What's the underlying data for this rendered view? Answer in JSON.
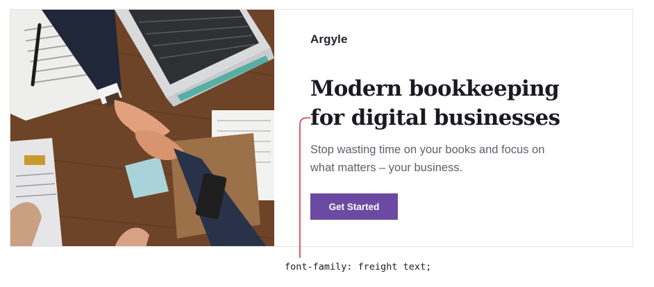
{
  "hero": {
    "brand": "Argyle",
    "headline_line1": "Modern bookkeeping",
    "headline_line2": "for digital businesses",
    "subline_line1": "Stop wasting time on your books and focus on",
    "subline_line2": "what matters – your business.",
    "cta_label": "Get Started",
    "photo_subject": "business-handshake-over-desk",
    "colors": {
      "cta_background": "#6b4aa3",
      "headline": "#1b1a22",
      "subline": "#5f5e6a",
      "annotation_line": "#d8343f"
    }
  },
  "annotation": {
    "caption": "font-family: freight text;"
  }
}
